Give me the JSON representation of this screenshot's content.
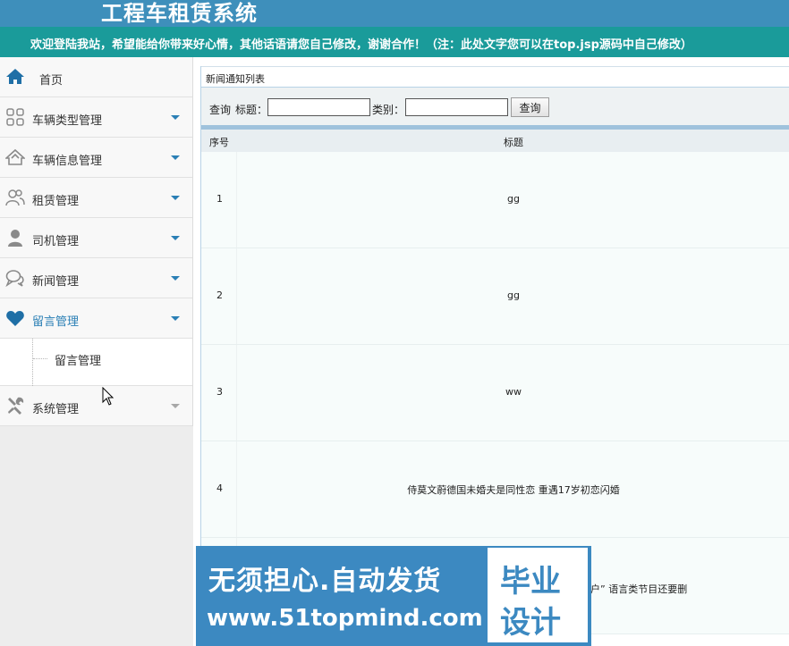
{
  "header": {
    "app_title": "工程车租赁系统",
    "welcome": "欢迎登陆我站，希望能给你带来好心情，其他话语请您自己修改，谢谢合作！（注：此处文字您可以在top.jsp源码中自己修改）"
  },
  "colors": {
    "topbar": "#3e8fbb",
    "welcome_bar": "#1a9b9a",
    "accent": "#2a7fb5",
    "watermark": "#3c89c1"
  },
  "sidebar": {
    "items": [
      {
        "label": "首页",
        "icon": "home-icon"
      },
      {
        "label": "车辆类型管理",
        "icon": "grid-icon"
      },
      {
        "label": "车辆信息管理",
        "icon": "house-icon"
      },
      {
        "label": "租赁管理",
        "icon": "users-icon"
      },
      {
        "label": "司机管理",
        "icon": "user-icon"
      },
      {
        "label": "新闻管理",
        "icon": "comments-icon"
      },
      {
        "label": "留言管理",
        "icon": "heart-icon",
        "expanded": true
      },
      {
        "label": "系统管理",
        "icon": "wrench-icon"
      }
    ],
    "submenu": {
      "label": "留言管理"
    }
  },
  "panel": {
    "title": "新闻通知列表"
  },
  "search": {
    "prefix": "查询",
    "title_label": "标题：",
    "title_value": "",
    "category_label": "类别：",
    "category_value": "",
    "button_label": "查询"
  },
  "table": {
    "headers": {
      "no": "序号",
      "title": "标题"
    },
    "rows": [
      {
        "no": "1",
        "title": "gg"
      },
      {
        "no": "2",
        "title": "gg"
      },
      {
        "no": "3",
        "title": "ww"
      },
      {
        "no": "4",
        "title": "侍莫文蔚德国未婚夫是同性恋 重遇17岁初恋闪婚"
      }
    ],
    "partial_row_text": "户” 语言类节目还要删"
  },
  "watermark": {
    "line1": "无须担心.自动发货",
    "line2": "www.51topmind.com",
    "badge_line1": "毕业",
    "badge_line2": "设计"
  }
}
